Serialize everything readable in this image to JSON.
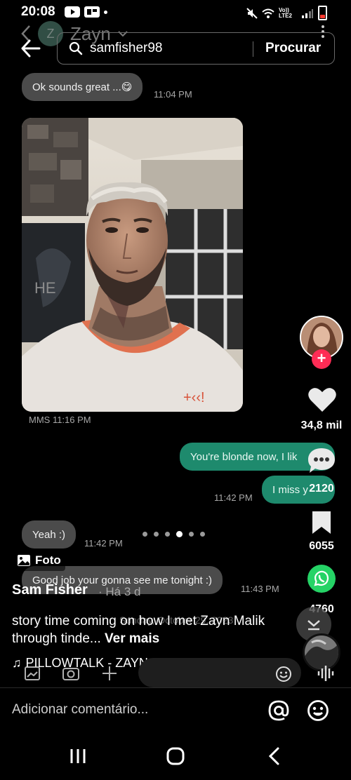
{
  "status_bar": {
    "time": "20:08",
    "network": "Vo)) LTE2"
  },
  "chat": {
    "contact_initial": "Z",
    "contact_name": "Zayn",
    "messages": [
      {
        "side": "in",
        "text": "Ok sounds great ...😋",
        "time": "11:04 PM"
      },
      {
        "side": "in",
        "type": "image",
        "time": "MMS 11:16 PM"
      },
      {
        "side": "out",
        "text": "You're blonde now, I lik",
        "time": ""
      },
      {
        "side": "out",
        "text": "I miss y",
        "time": "11:42 PM"
      },
      {
        "side": "in",
        "text": "Yeah :)",
        "time": "11:42 PM"
      },
      {
        "side": "in",
        "text": "Good job your gonna see me tonight :)",
        "time": "11:43 PM"
      }
    ],
    "date_separator": "Sunday, October 29, 2023"
  },
  "search": {
    "query": "samfisher98",
    "button_label": "Procurar"
  },
  "post": {
    "likes": "34,8 mil",
    "comments": "2120",
    "saves": "6055",
    "shares": "4760",
    "foto_label": "Foto",
    "author": "Sam Fisher",
    "ago": "· Há 3 d",
    "caption_text": "story time coming on how I met Zayn Malik through tinde...",
    "see_more": "Ver mais",
    "music": "PILLOWTALK - ZAYN",
    "carousel_count": 6,
    "carousel_active": 4,
    "comment_placeholder": "Adicionar comentário...",
    "accent_red": "#fe2c55",
    "whatsapp_green": "#25d366",
    "sent_bubble_green": "#1e8a6d"
  }
}
